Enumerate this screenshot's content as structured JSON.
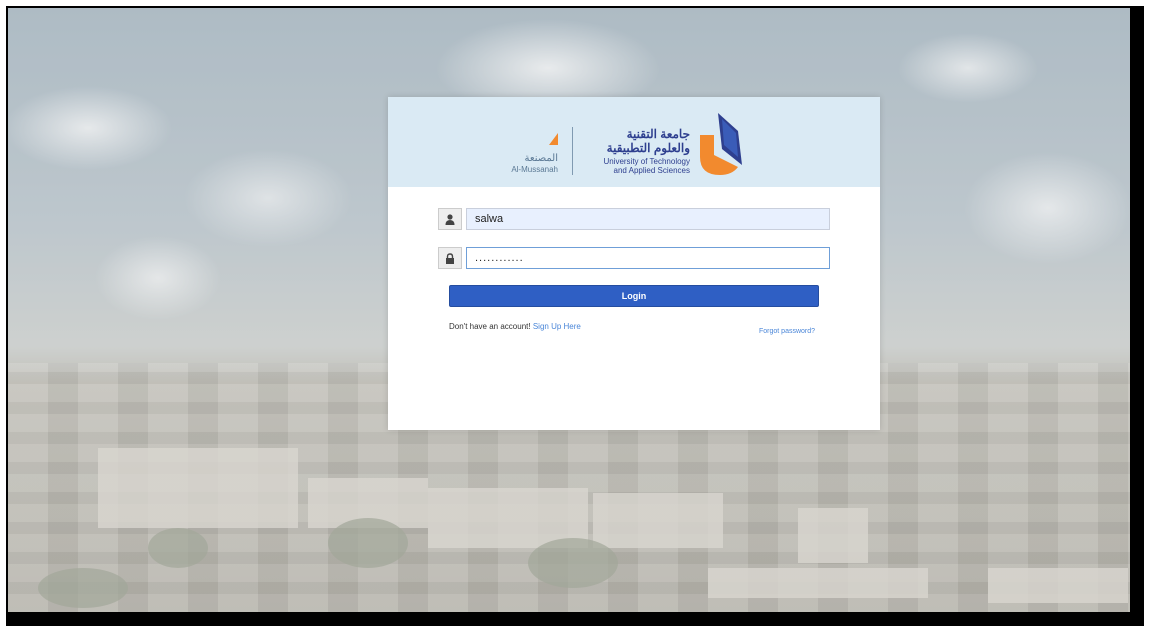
{
  "header": {
    "campus_arabic": "المصنعة",
    "campus_english": "Al-Mussanah",
    "university_arabic_line1": "جامعة التقنية",
    "university_arabic_line2": "والعلوم التطبيقية",
    "university_english_line1": "University of Technology",
    "university_english_line2": "and Applied Sciences"
  },
  "form": {
    "username_value": "salwa",
    "password_value": "............",
    "login_label": "Login",
    "signup_prompt": "Don't have an account!",
    "signup_link": "Sign Up Here",
    "forgot_link": "Forgot password?"
  },
  "colors": {
    "header_bg": "#daeaf4",
    "primary_button": "#2f5fc4",
    "link": "#4a86d8",
    "logo_orange": "#f28a2e",
    "logo_blue": "#2e3f8f"
  },
  "icons": {
    "username": "user-icon",
    "password": "lock-icon"
  }
}
